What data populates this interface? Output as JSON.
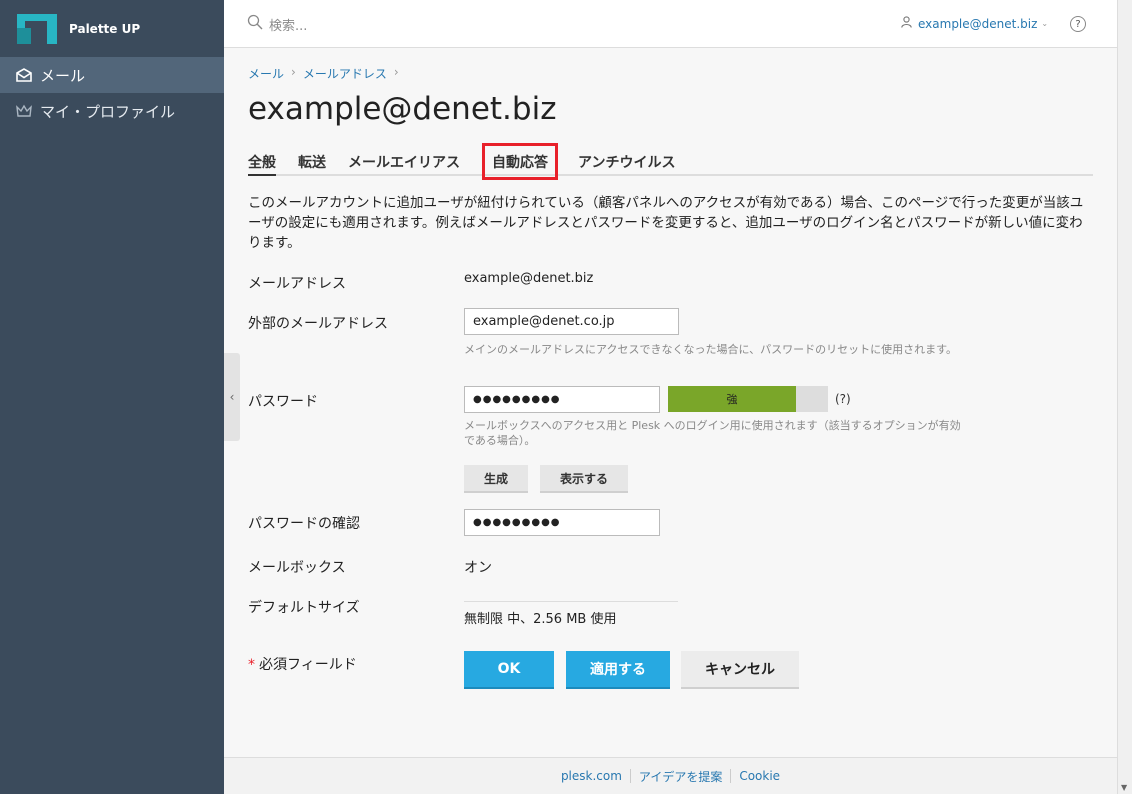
{
  "sidebar": {
    "brand": "Palette UP",
    "items": [
      {
        "label": "メール",
        "icon": "mail-icon",
        "active": true
      },
      {
        "label": "マイ・プロファイル",
        "icon": "crown-icon",
        "active": false
      }
    ]
  },
  "header": {
    "search_placeholder": "検索...",
    "user": "example@denet.biz",
    "help": "?"
  },
  "breadcrumb": [
    "メール",
    "メールアドレス"
  ],
  "page_title": "example@denet.biz",
  "tabs": [
    "全般",
    "転送",
    "メールエイリアス",
    "自動応答",
    "アンチウイルス"
  ],
  "description": "このメールアカウントに追加ユーザが紐付けられている（顧客パネルへのアクセスが有効である）場合、このページで行った変更が当該ユーザの設定にも適用されます。例えばメールアドレスとパスワードを変更すると、追加ユーザのログイン名とパスワードが新しい値に変わります。",
  "form": {
    "email_label": "メールアドレス",
    "email_value": "example@denet.biz",
    "external_label": "外部のメールアドレス",
    "external_value": "example@denet.co.jp",
    "external_hint": "メインのメールアドレスにアクセスできなくなった場合に、パスワードのリセットに使用されます。",
    "password_label": "パスワード",
    "password_value": "●●●●●●●●●",
    "strength_label": "強",
    "strength_level": 0.8,
    "strength_help": "(?)",
    "password_hint": "メールボックスへのアクセス用と Plesk へのログイン用に使用されます（該当するオプションが有効である場合）。",
    "generate_label": "生成",
    "show_label": "表示する",
    "confirm_label": "パスワードの確認",
    "confirm_value": "●●●●●●●●●",
    "mailbox_label": "メールボックス",
    "mailbox_value": "オン",
    "size_label": "デフォルトサイズ",
    "size_value": "無制限 中、2.56 MB 使用",
    "required_label": "必須フィールド",
    "required_star": "*"
  },
  "buttons": {
    "ok": "OK",
    "apply": "適用する",
    "cancel": "キャンセル"
  },
  "footer": [
    "plesk.com",
    "アイデアを提案",
    "Cookie"
  ],
  "colors": {
    "sidebar": "#3b4b5c",
    "accent": "#27a9e1",
    "strength": "#7aa629",
    "highlight": "#e8202a"
  }
}
